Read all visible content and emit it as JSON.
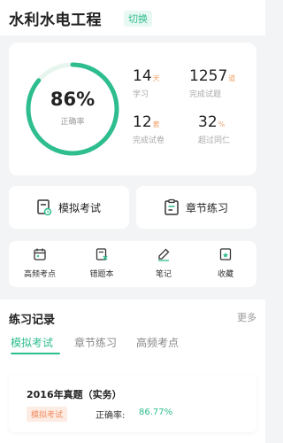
{
  "header": {
    "title": "水利水电工程",
    "switch_label": "切换"
  },
  "stats": {
    "accuracy": {
      "value": "86%",
      "label": "正确率",
      "fraction": 0.86
    },
    "study_days": {
      "value": "14",
      "unit": "天",
      "label": "学习"
    },
    "questions_done": {
      "value": "1257",
      "unit": "道",
      "label": "完成试题"
    },
    "papers_done": {
      "value": "12",
      "unit": "套",
      "label": "完成试卷"
    },
    "beat_peers": {
      "value": "32",
      "unit": "%",
      "label": "超过同仁"
    }
  },
  "actions": {
    "mock_exam": "模拟考试",
    "chapter_practice": "章节练习"
  },
  "tools": {
    "high_freq": "高频考点",
    "wrong_book": "错题本",
    "notes": "笔记",
    "favorites": "收藏"
  },
  "records": {
    "title": "练习记录",
    "more": "更多",
    "tabs": [
      "模拟考试",
      "章节练习",
      "高频考点"
    ],
    "items": [
      {
        "name": "2016年真题（实务）",
        "tag": "模拟考试",
        "accuracy_label": "正确率:",
        "accuracy_value": "86.77%"
      }
    ]
  },
  "colors": {
    "accent": "#2ebd8f",
    "tag_orange": "#f08c62",
    "unit_orange": "#f0a46e"
  }
}
